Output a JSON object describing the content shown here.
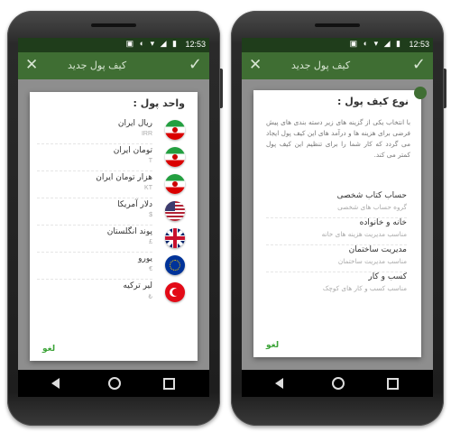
{
  "status": {
    "time": "12:53",
    "icons": "▣ ◐ ▾ ◢ ▮"
  },
  "left": {
    "appbar": {
      "title": "کیف پول جدید"
    },
    "dialog": {
      "title": "واحد پول :",
      "items": [
        {
          "name": "ریال ایران",
          "code": "IRR",
          "flag": "iran"
        },
        {
          "name": "تومان ایران",
          "code": "T",
          "flag": "iran"
        },
        {
          "name": "هزار تومان ایران",
          "code": "KT",
          "flag": "iran"
        },
        {
          "name": "دلار آمریکا",
          "code": "$",
          "flag": "usa"
        },
        {
          "name": "پوند انگلستان",
          "code": "£",
          "flag": "uk"
        },
        {
          "name": "یورو",
          "code": "€",
          "flag": "eu"
        },
        {
          "name": "لیر ترکیه",
          "code": "₺",
          "flag": "tr"
        }
      ],
      "cancel": "لغو"
    }
  },
  "right": {
    "appbar": {
      "title": "کیف پول جدید"
    },
    "dialog": {
      "title": "نوع کیف پول :",
      "description": "با انتخاب یکی از گزینه های زیر دسته بندی های پیش فرضی برای هزینه ها و درآمد های این کیف پول ایجاد می گردد که کار شما را برای تنظیم این کیف پول کمتر می کند.",
      "items": [
        {
          "name": "حساب کتاب شخصی",
          "sub": "گروه حساب های شخصی"
        },
        {
          "name": "خانه و خانواده",
          "sub": "مناسب مدیریت هزینه های خانه"
        },
        {
          "name": "مدیریت ساختمان",
          "sub": "مناسب مدیریت ساختمان"
        },
        {
          "name": "کسب و کار",
          "sub": "مناسب کسب و کار های کوچک"
        }
      ],
      "cancel": "لغو"
    }
  },
  "colors": {
    "appbar": "#3f6e33",
    "statusbar": "#1f3d1b",
    "accent": "#3aa336"
  }
}
